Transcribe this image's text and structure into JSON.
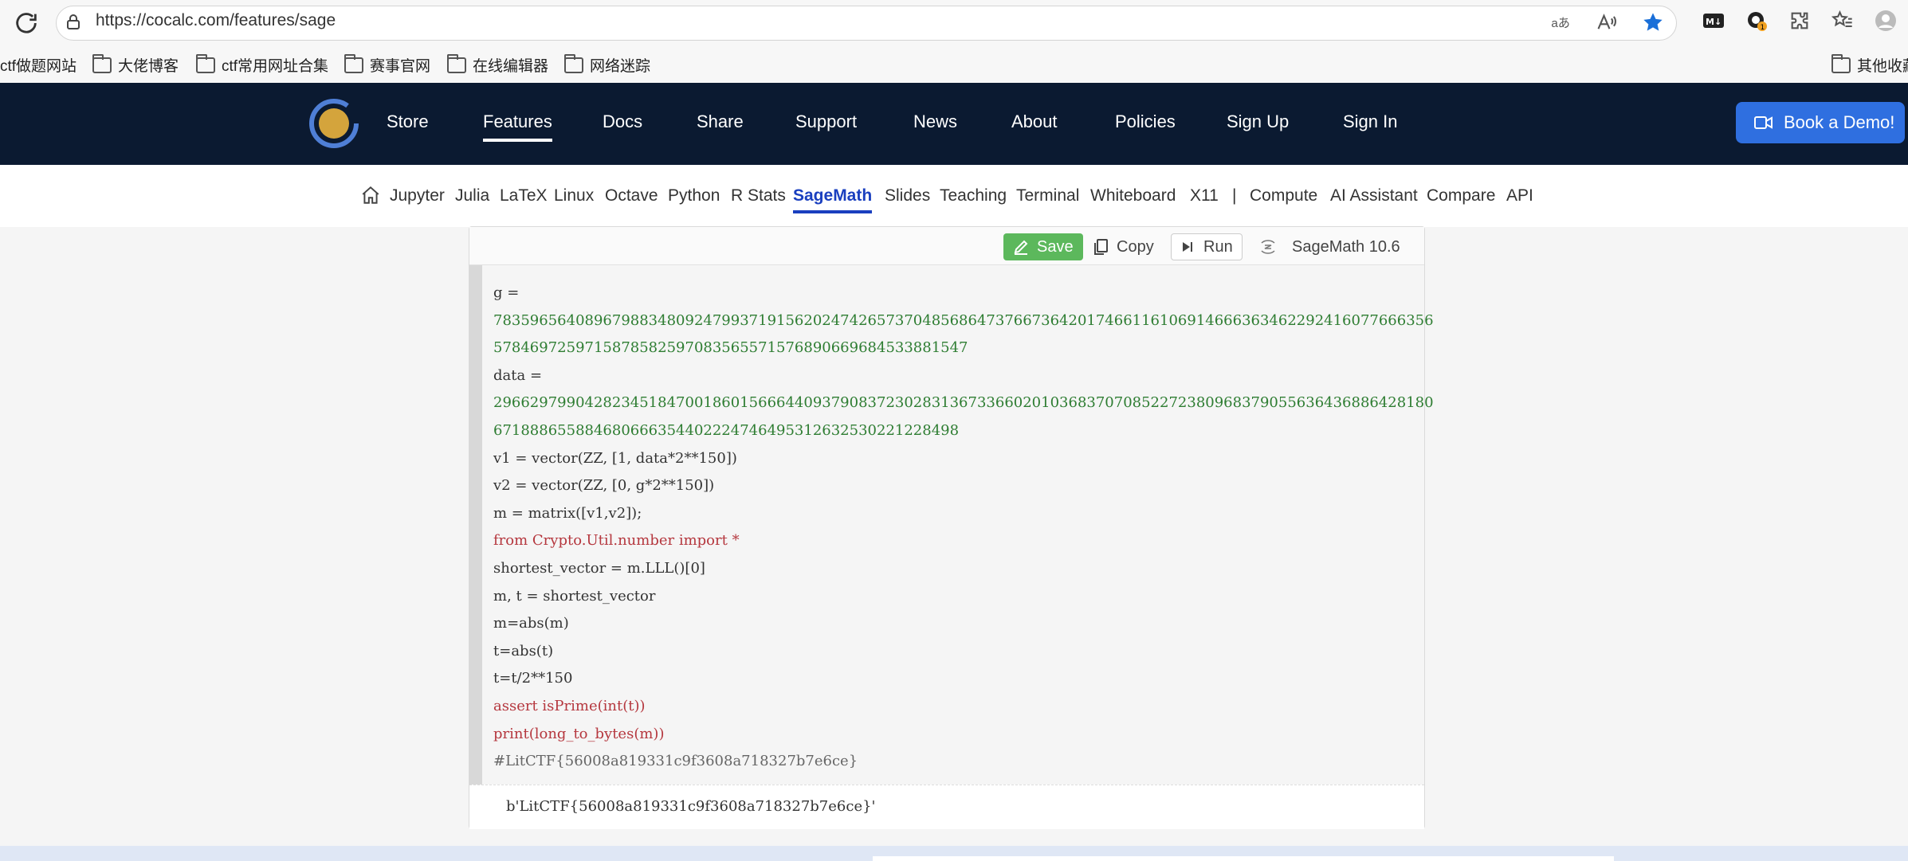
{
  "browser": {
    "url": "https://cocalc.com/features/sage",
    "bookmarks": [
      "ctf做题网站",
      "大佬博客",
      "ctf常用网址合集",
      "赛事官网",
      "在线编辑器",
      "网络迷踪"
    ],
    "other_bookmarks": "其他收藏"
  },
  "site_nav": {
    "items": [
      "Store",
      "Features",
      "Docs",
      "Share",
      "Support",
      "News",
      "About",
      "Policies",
      "Sign Up",
      "Sign In"
    ],
    "active": "Features",
    "book_demo": "Book a Demo!"
  },
  "sub_nav": {
    "items": [
      "Jupyter",
      "Julia",
      "LaTeX",
      "Linux",
      "Octave",
      "Python",
      "R Stats",
      "SageMath",
      "Slides",
      "Teaching",
      "Terminal",
      "Whiteboard",
      "X11",
      "|",
      "Compute",
      "AI Assistant",
      "Compare",
      "API"
    ],
    "active": "SageMath"
  },
  "toolbar": {
    "save": "Save",
    "copy": "Copy",
    "run": "Run",
    "kernel": "SageMath 10.6"
  },
  "code": {
    "g_label": "g =",
    "g_value_1": "7835965640896798834809247993719156202474265737048568647376673642017466116106914666363462292416077666356",
    "g_value_2": "5784697259715878582597083565571576890669684533881547",
    "data_label": "data =",
    "data_value_1": "2966297990428234518470018601566644093790837230283136733660201036837070852272380968379055636436886428180",
    "data_value_2": "6718886558846806663544022247464953126325302212284​98",
    "line_v1": "v1 = vector(ZZ, [1, data*2**150])",
    "line_v2": "v2 = vector(ZZ, [0, g*2**150])",
    "line_m": "m = matrix([v1,v2]);",
    "line_import": "from Crypto.Util.number import *",
    "line_sv": "shortest_vector = m.LLL()[0]",
    "line_mt": "m, t = shortest_vector",
    "line_absm": "m=abs(m)",
    "line_abst": "t=abs(t)",
    "line_div": "t=t/2**150",
    "line_assert": "assert isPrime(int(t))",
    "line_print": "print(long_to_bytes(m))",
    "line_comment": "#LitCTF{56008a819331c9f3608a718327b7e6ce}"
  },
  "output": "b'LitCTF{56008a819331c9f3608a718327b7e6ce}'",
  "colors": {
    "nav_bg": "#0b1a31",
    "accent": "#2f6fe0",
    "save_green": "#5cb85c",
    "number_green": "#2e7d32",
    "keyword_red": "#b5373e"
  }
}
